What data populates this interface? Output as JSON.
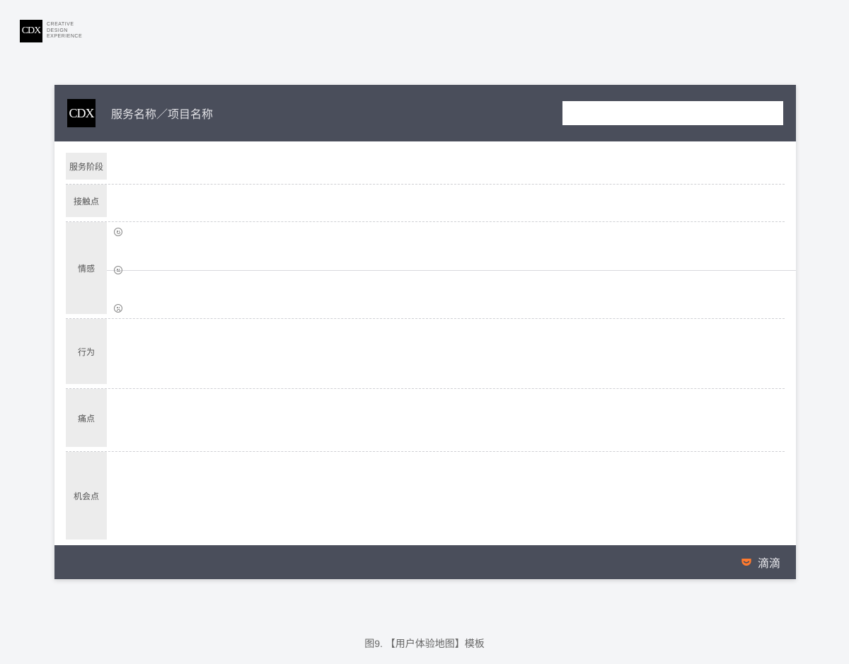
{
  "logo": {
    "mark": "CDX",
    "sub_line1": "CREATIVE",
    "sub_line2": "DESIGN",
    "sub_line3": "EXPERIENCE"
  },
  "header": {
    "title": "服务名称／项目名称"
  },
  "rows": {
    "stage": "服务阶段",
    "touch": "接触点",
    "emotion": "情感",
    "behavior": "行为",
    "pain": "痛点",
    "opportunity": "机会点"
  },
  "footer": {
    "brand": "滴滴"
  },
  "caption": "图9. 【用户体验地图】模板"
}
